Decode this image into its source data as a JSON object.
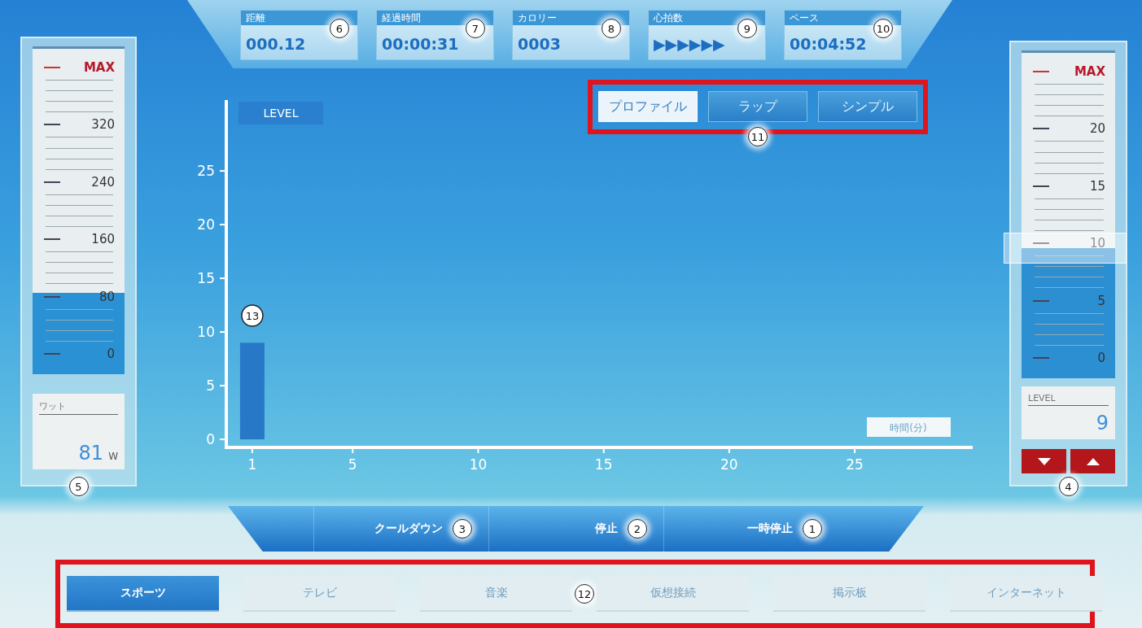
{
  "metrics": [
    {
      "label": "距離",
      "value": "000.12",
      "callout": "6"
    },
    {
      "label": "経過時間",
      "value": "00:00:31",
      "callout": "7"
    },
    {
      "label": "カロリー",
      "value": "0003",
      "callout": "8"
    },
    {
      "label": "心拍数",
      "value": "▶▶▶▶▶▶",
      "callout": "9"
    },
    {
      "label": "ペース",
      "value": "00:04:52",
      "callout": "10"
    }
  ],
  "power_gauge": {
    "kind": "meter",
    "scale": [
      "MAX",
      "320",
      "240",
      "160",
      "80",
      "0"
    ],
    "level": 0.25,
    "readout": {
      "label": "ワット",
      "value": "81",
      "unit": "W"
    },
    "callout": "5"
  },
  "level_gauge": {
    "kind": "slider",
    "scale": [
      "MAX",
      "20",
      "15",
      "10",
      "5",
      "0"
    ],
    "level": 0.4,
    "readout": {
      "label": "LEVEL",
      "value": "9"
    },
    "callout": "4"
  },
  "chart": {
    "view_buttons": [
      {
        "label": "プロファイル",
        "selected": true
      },
      {
        "label": "ラップ",
        "selected": false,
        "callout": "11"
      },
      {
        "label": "シンプル",
        "selected": false
      }
    ],
    "bar_callout": "13",
    "chart_data": {
      "type": "bar",
      "ylabel": "LEVEL",
      "xlabel": "時間(分)",
      "x": [
        1
      ],
      "values": [
        9
      ],
      "xlim": [
        -0.1,
        29.7
      ],
      "ylim": [
        -0.9,
        31.6
      ],
      "xticks": [
        1,
        5,
        10,
        15,
        20,
        25
      ],
      "yticks": [
        0,
        5,
        10,
        15,
        20,
        25
      ]
    }
  },
  "controls": [
    {
      "label": "クールダウン",
      "callout": "3"
    },
    {
      "label": "停止",
      "callout": "2"
    },
    {
      "label": "一時停止",
      "callout": "1"
    }
  ],
  "tabs": [
    {
      "label": "スポーツ",
      "selected": true
    },
    {
      "label": "テレビ",
      "selected": false
    },
    {
      "label": "音楽",
      "selected": false,
      "callout": "12"
    },
    {
      "label": "仮想接続",
      "selected": false
    },
    {
      "label": "掲示板",
      "selected": false
    },
    {
      "label": "インターネット",
      "selected": false
    }
  ]
}
